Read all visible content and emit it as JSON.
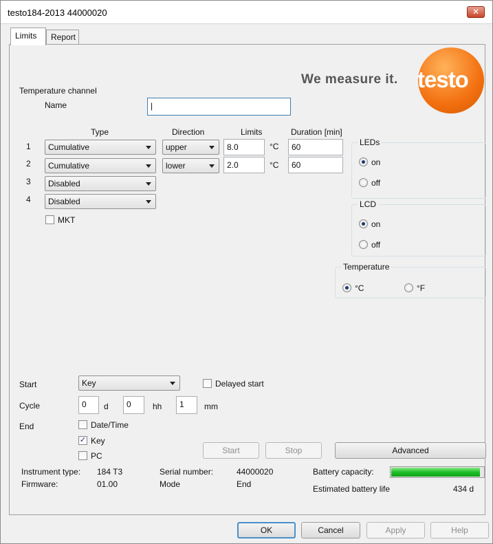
{
  "window": {
    "title": "testo184-2013 44000020",
    "close_label": "✕"
  },
  "tabs": [
    {
      "label": "Limits"
    },
    {
      "label": "Report"
    }
  ],
  "logo": {
    "tagline": "We measure it.",
    "wordmark": "testo"
  },
  "channel": {
    "section_label": "Temperature channel",
    "name_label": "Name",
    "name_value": "|"
  },
  "table": {
    "headers": {
      "type": "Type",
      "direction": "Direction",
      "limits": "Limits",
      "duration": "Duration [min]"
    },
    "rows": [
      {
        "num": "1",
        "type": "Cumulative",
        "direction": "upper",
        "limit": "8.0",
        "unit": "°C",
        "duration": "60"
      },
      {
        "num": "2",
        "type": "Cumulative",
        "direction": "lower",
        "limit": "2.0",
        "unit": "°C",
        "duration": "60"
      },
      {
        "num": "3",
        "type": "Disabled"
      },
      {
        "num": "4",
        "type": "Disabled"
      }
    ],
    "mkt_label": "MKT"
  },
  "leds": {
    "legend": "LEDs",
    "on": "on",
    "off": "off"
  },
  "lcd": {
    "legend": "LCD",
    "on": "on",
    "off": "off"
  },
  "temperature": {
    "legend": "Temperature",
    "celsius": "°C",
    "fahrenheit": "°F"
  },
  "start": {
    "label": "Start",
    "value": "Key",
    "delayed_label": "Delayed start"
  },
  "cycle": {
    "label": "Cycle",
    "d": "0",
    "d_unit": "d",
    "hh": "0",
    "hh_unit": "hh",
    "mm": "1",
    "mm_unit": "mm"
  },
  "end": {
    "label": "End",
    "datetime": "Date/Time",
    "key": "Key",
    "pc": "PC",
    "check_mark": "✓"
  },
  "buttons": {
    "start": "Start",
    "stop": "Stop",
    "advanced": "Advanced"
  },
  "info": {
    "instrument_type_label": "Instrument type:",
    "instrument_type": "184 T3",
    "firmware_label": "Firmware:",
    "firmware": "01.00",
    "serial_label": "Serial number:",
    "serial": "44000020",
    "mode_label": "Mode",
    "mode": "End",
    "battery_capacity_label": "Battery capacity:",
    "battery_level_percent": 96,
    "battery_life_label": "Estimated battery life",
    "battery_life": "434 d"
  },
  "footer": {
    "ok": "OK",
    "cancel": "Cancel",
    "apply": "Apply",
    "help": "Help"
  }
}
